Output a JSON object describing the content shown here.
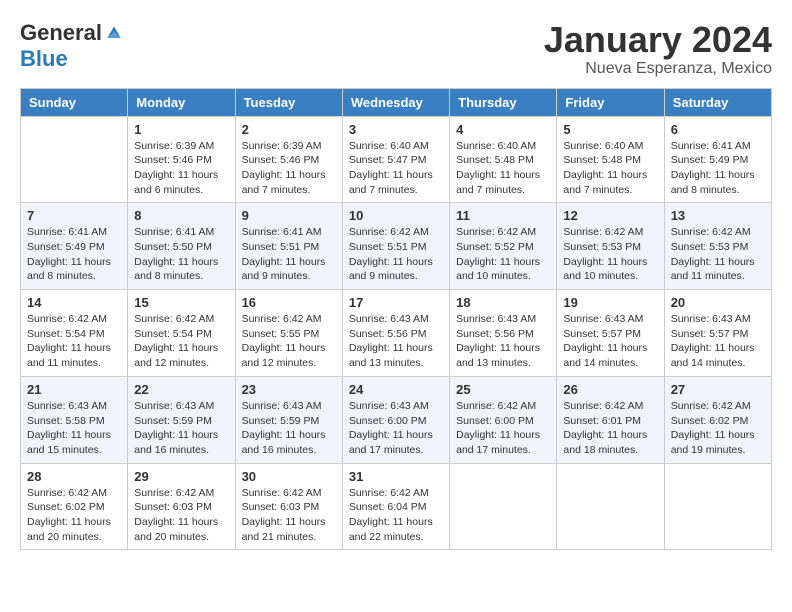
{
  "logo": {
    "general": "General",
    "blue": "Blue"
  },
  "title": "January 2024",
  "location": "Nueva Esperanza, Mexico",
  "days_of_week": [
    "Sunday",
    "Monday",
    "Tuesday",
    "Wednesday",
    "Thursday",
    "Friday",
    "Saturday"
  ],
  "weeks": [
    [
      {
        "day": "",
        "info": ""
      },
      {
        "day": "1",
        "info": "Sunrise: 6:39 AM\nSunset: 5:46 PM\nDaylight: 11 hours and 6 minutes."
      },
      {
        "day": "2",
        "info": "Sunrise: 6:39 AM\nSunset: 5:46 PM\nDaylight: 11 hours and 7 minutes."
      },
      {
        "day": "3",
        "info": "Sunrise: 6:40 AM\nSunset: 5:47 PM\nDaylight: 11 hours and 7 minutes."
      },
      {
        "day": "4",
        "info": "Sunrise: 6:40 AM\nSunset: 5:48 PM\nDaylight: 11 hours and 7 minutes."
      },
      {
        "day": "5",
        "info": "Sunrise: 6:40 AM\nSunset: 5:48 PM\nDaylight: 11 hours and 7 minutes."
      },
      {
        "day": "6",
        "info": "Sunrise: 6:41 AM\nSunset: 5:49 PM\nDaylight: 11 hours and 8 minutes."
      }
    ],
    [
      {
        "day": "7",
        "info": "Sunrise: 6:41 AM\nSunset: 5:49 PM\nDaylight: 11 hours and 8 minutes."
      },
      {
        "day": "8",
        "info": "Sunrise: 6:41 AM\nSunset: 5:50 PM\nDaylight: 11 hours and 8 minutes."
      },
      {
        "day": "9",
        "info": "Sunrise: 6:41 AM\nSunset: 5:51 PM\nDaylight: 11 hours and 9 minutes."
      },
      {
        "day": "10",
        "info": "Sunrise: 6:42 AM\nSunset: 5:51 PM\nDaylight: 11 hours and 9 minutes."
      },
      {
        "day": "11",
        "info": "Sunrise: 6:42 AM\nSunset: 5:52 PM\nDaylight: 11 hours and 10 minutes."
      },
      {
        "day": "12",
        "info": "Sunrise: 6:42 AM\nSunset: 5:53 PM\nDaylight: 11 hours and 10 minutes."
      },
      {
        "day": "13",
        "info": "Sunrise: 6:42 AM\nSunset: 5:53 PM\nDaylight: 11 hours and 11 minutes."
      }
    ],
    [
      {
        "day": "14",
        "info": "Sunrise: 6:42 AM\nSunset: 5:54 PM\nDaylight: 11 hours and 11 minutes."
      },
      {
        "day": "15",
        "info": "Sunrise: 6:42 AM\nSunset: 5:54 PM\nDaylight: 11 hours and 12 minutes."
      },
      {
        "day": "16",
        "info": "Sunrise: 6:42 AM\nSunset: 5:55 PM\nDaylight: 11 hours and 12 minutes."
      },
      {
        "day": "17",
        "info": "Sunrise: 6:43 AM\nSunset: 5:56 PM\nDaylight: 11 hours and 13 minutes."
      },
      {
        "day": "18",
        "info": "Sunrise: 6:43 AM\nSunset: 5:56 PM\nDaylight: 11 hours and 13 minutes."
      },
      {
        "day": "19",
        "info": "Sunrise: 6:43 AM\nSunset: 5:57 PM\nDaylight: 11 hours and 14 minutes."
      },
      {
        "day": "20",
        "info": "Sunrise: 6:43 AM\nSunset: 5:57 PM\nDaylight: 11 hours and 14 minutes."
      }
    ],
    [
      {
        "day": "21",
        "info": "Sunrise: 6:43 AM\nSunset: 5:58 PM\nDaylight: 11 hours and 15 minutes."
      },
      {
        "day": "22",
        "info": "Sunrise: 6:43 AM\nSunset: 5:59 PM\nDaylight: 11 hours and 16 minutes."
      },
      {
        "day": "23",
        "info": "Sunrise: 6:43 AM\nSunset: 5:59 PM\nDaylight: 11 hours and 16 minutes."
      },
      {
        "day": "24",
        "info": "Sunrise: 6:43 AM\nSunset: 6:00 PM\nDaylight: 11 hours and 17 minutes."
      },
      {
        "day": "25",
        "info": "Sunrise: 6:42 AM\nSunset: 6:00 PM\nDaylight: 11 hours and 17 minutes."
      },
      {
        "day": "26",
        "info": "Sunrise: 6:42 AM\nSunset: 6:01 PM\nDaylight: 11 hours and 18 minutes."
      },
      {
        "day": "27",
        "info": "Sunrise: 6:42 AM\nSunset: 6:02 PM\nDaylight: 11 hours and 19 minutes."
      }
    ],
    [
      {
        "day": "28",
        "info": "Sunrise: 6:42 AM\nSunset: 6:02 PM\nDaylight: 11 hours and 20 minutes."
      },
      {
        "day": "29",
        "info": "Sunrise: 6:42 AM\nSunset: 6:03 PM\nDaylight: 11 hours and 20 minutes."
      },
      {
        "day": "30",
        "info": "Sunrise: 6:42 AM\nSunset: 6:03 PM\nDaylight: 11 hours and 21 minutes."
      },
      {
        "day": "31",
        "info": "Sunrise: 6:42 AM\nSunset: 6:04 PM\nDaylight: 11 hours and 22 minutes."
      },
      {
        "day": "",
        "info": ""
      },
      {
        "day": "",
        "info": ""
      },
      {
        "day": "",
        "info": ""
      }
    ]
  ]
}
